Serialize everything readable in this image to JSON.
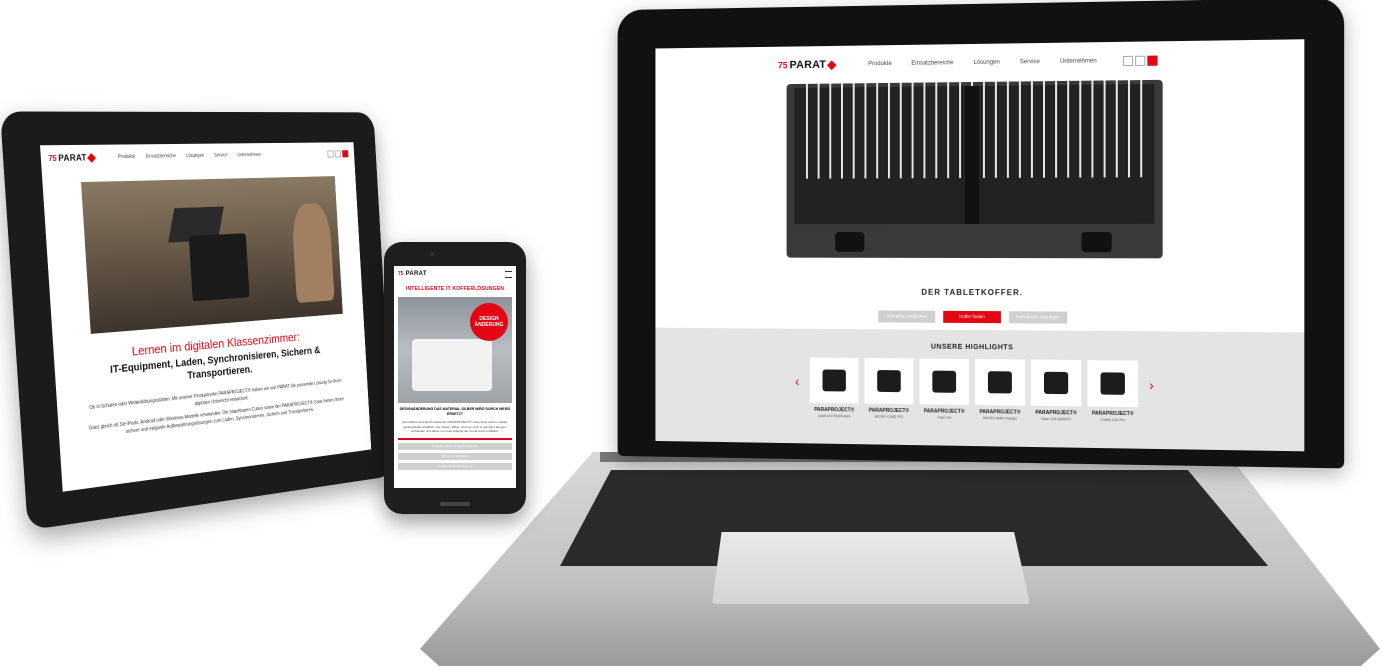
{
  "brand": {
    "logo_number": "75",
    "logo_text": "PARAT"
  },
  "nav": {
    "items": [
      "Produkte",
      "Einsatzbereiche",
      "Lösungen",
      "Service",
      "Unternehmen"
    ],
    "search_icon": "search-icon",
    "lang_flag": "DE"
  },
  "tablet": {
    "headline": "Lernen im digitalen Klassenzimmer:",
    "subheadline": "IT-Equipment, Laden, Synchronisieren, Sichern & Transportieren.",
    "body_1": "Ob in Schulen oder Weiterbildungsstätten: Mit unserer Produktreihe PARAPROJECT® haben wir von PARAT die passende Lösung für Ihren digitalen Unterricht entwickelt.",
    "body_2": "Ganz gleich ob Sie iPads, Android oder Windows-Modelle verwenden: Die stapelbaren Cubes sowie der PARAPROJECT® Case bieten Ihnen sichere und elegante Aufbewahrungslösungen zum Laden, Synchronisieren, Sichern und Transportieren."
  },
  "phone": {
    "headline": "INTELLIGENTE IT KOFFERLÖSUNGEN",
    "badge": "DESIGN ÄNDERUNG",
    "caption": "DESIGNÄNDERUNG DAS MATERIAL SILBER WIRD DURCH WEISS ERSETZT",
    "body": "Demnächst sind die Produkte der PARAPROJECT® Case Serie auch in weißer Außenschale erhältlich. Der Cases „Silber“ wird nur noch in geringen Mengen vorhanden und daher nur noch solange der Vorrat reicht erhältlich.",
    "buttons": [
      "Produkte Laden & Synchronisieren",
      "Sichern & Verwalten",
      "Intelligente Mobile Lösung"
    ]
  },
  "laptop": {
    "tagline": "DER TABLETKOFFER.",
    "buttons": [
      "Schränke entdecken",
      "Koffer finden",
      "Individuelle Lösungen"
    ],
    "highlights_title": "UNSERE HIGHLIGHTS",
    "highlights": [
      {
        "name": "PARAPROJECT®",
        "sub": "Case U10 Roll/Cases"
      },
      {
        "name": "PARAPROJECT®",
        "sub": "MICRO CASE P12"
      },
      {
        "name": "PARAPROJECT®",
        "sub": "Case Uni"
      },
      {
        "name": "PARAPROJECT®",
        "sub": "MICRO Multi-Charger"
      },
      {
        "name": "PARAPROJECT®",
        "sub": "Case U16 BASKET"
      },
      {
        "name": "PARAPROJECT®",
        "sub": "Trolley U12 Pro"
      }
    ],
    "prev_arrow": "‹",
    "next_arrow": "›"
  },
  "colors": {
    "brand_red": "#e30613",
    "device_black": "#111111",
    "laptop_silver": "#c8c8c8"
  }
}
